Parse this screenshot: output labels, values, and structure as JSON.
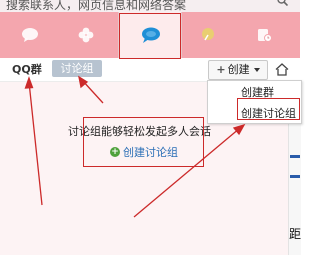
{
  "search": {
    "placeholder": "搜索联系人，网页信息和网络答案"
  },
  "tabs": [
    {
      "icon": "chat-bubble-icon"
    },
    {
      "icon": "clover-icon"
    },
    {
      "icon": "group-chat-icon",
      "selected": true
    },
    {
      "icon": "leaf-icon"
    },
    {
      "icon": "history-icon"
    }
  ],
  "subbar": {
    "qq_group_label": "QQ群",
    "discussion_tab_label": "讨论组",
    "create_label": "创建",
    "create_plus": "+"
  },
  "dropdown": {
    "items": [
      "创建群",
      "创建讨论组"
    ]
  },
  "main": {
    "message": "讨论组能够轻松发起多人会话",
    "create_link": "创建讨论组",
    "create_link_icon": "+"
  },
  "right_edge": {
    "glyph": "距"
  },
  "colors": {
    "tab_bar": "#f4a6ae",
    "annotation_red": "#cc2a2a",
    "link_blue": "#2b6fb6",
    "content_bg": "#fdf3f4"
  }
}
